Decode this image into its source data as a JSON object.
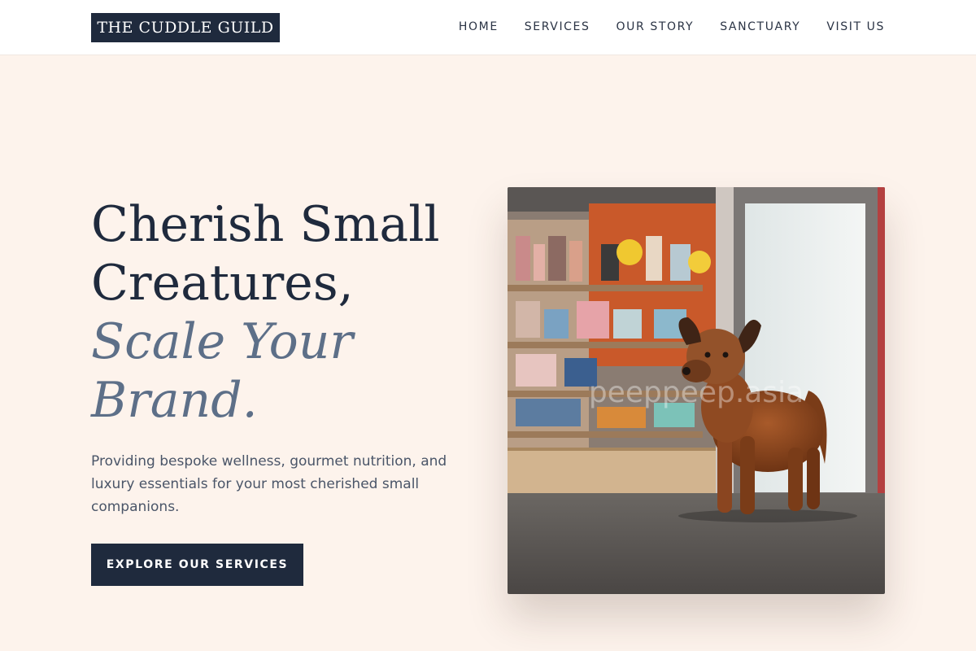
{
  "brand": {
    "name": "THE CUDDLE GUILD"
  },
  "nav": {
    "items": [
      {
        "label": "HOME"
      },
      {
        "label": "SERVICES"
      },
      {
        "label": "OUR STORY"
      },
      {
        "label": "SANCTUARY"
      },
      {
        "label": "VISIT US"
      }
    ]
  },
  "hero": {
    "title_line1": "Cherish Small",
    "title_line2": "Creatures,",
    "title_accent_line1": "Scale Your",
    "title_accent_line2": "Brand.",
    "subtitle": "Providing bespoke wellness, gourmet nutrition, and luxury essentials for your most cherished small companions.",
    "cta_label": "EXPLORE OUR SERVICES",
    "image_watermark": "peeppeep.asia"
  },
  "colors": {
    "background": "#fdf3ec",
    "navy": "#1f2a3d",
    "slate_accent": "#5d6f88"
  }
}
